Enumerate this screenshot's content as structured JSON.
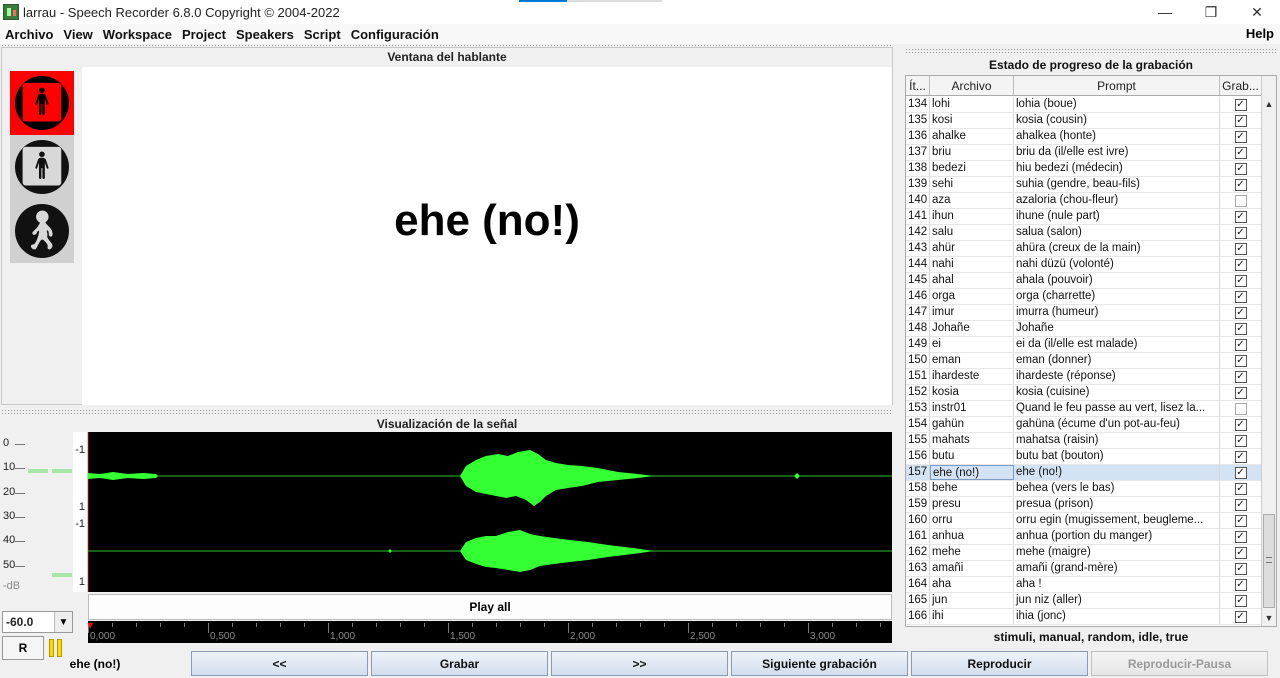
{
  "window": {
    "title": "larrau - Speech Recorder 6.8.0 Copyright © 2004-2022",
    "controls": [
      "—",
      "❐",
      "✕"
    ]
  },
  "menu": {
    "items": [
      "Archivo",
      "View",
      "Workspace",
      "Project",
      "Speakers",
      "Script",
      "Configuración"
    ],
    "help": "Help"
  },
  "speaker_window": {
    "title": "Ventana del hablante",
    "prompt": "ehe (no!)",
    "lights": [
      "stop",
      "wait",
      "go"
    ]
  },
  "signal": {
    "title": "Visualización de la señal",
    "meter_labels": [
      "0",
      "10",
      "20",
      "30",
      "40",
      "50"
    ],
    "meter_unit": "-dB",
    "db_value": "-60.0",
    "r_label": "R",
    "channel_axis": [
      "-1",
      "1",
      "-1",
      "1"
    ],
    "play_all": "Play all",
    "timeline": [
      "0,000",
      "0,500",
      "1,000",
      "1,500",
      "2,000",
      "2,500",
      "3,000"
    ]
  },
  "progress": {
    "title": "Estado de progreso de la grabación",
    "columns": [
      "Ít...",
      "Archivo",
      "Prompt",
      "Grab..."
    ],
    "rows": [
      {
        "n": "134",
        "file": "lohi",
        "prompt": "lohia (boue)",
        "rec": "✓"
      },
      {
        "n": "135",
        "file": "kosi",
        "prompt": "kosia (cousin)",
        "rec": "✓"
      },
      {
        "n": "136",
        "file": "ahalke",
        "prompt": "ahalkea (honte)",
        "rec": "✓"
      },
      {
        "n": "137",
        "file": "briu",
        "prompt": "briu da (il/elle est ivre)",
        "rec": "✓"
      },
      {
        "n": "138",
        "file": "bedezi",
        "prompt": "hiu bedezi (médecin)",
        "rec": "✓"
      },
      {
        "n": "139",
        "file": "sehi",
        "prompt": "suhia (gendre, beau-fils)",
        "rec": "✓"
      },
      {
        "n": "140",
        "file": "aza",
        "prompt": "azaloria (chou-fleur)",
        "rec": ""
      },
      {
        "n": "141",
        "file": "ihun",
        "prompt": "ihune (nule part)",
        "rec": "✓"
      },
      {
        "n": "142",
        "file": "salu",
        "prompt": "salua (salon)",
        "rec": "✓"
      },
      {
        "n": "143",
        "file": "ahür",
        "prompt": "ahüra (creux de la main)",
        "rec": "✓"
      },
      {
        "n": "144",
        "file": "nahi",
        "prompt": "nahi düzü (volonté)",
        "rec": "✓"
      },
      {
        "n": "145",
        "file": "ahal",
        "prompt": "ahala (pouvoir)",
        "rec": "✓"
      },
      {
        "n": "146",
        "file": "orga",
        "prompt": "orga (charrette)",
        "rec": "✓"
      },
      {
        "n": "147",
        "file": "imur",
        "prompt": "imurra (humeur)",
        "rec": "✓"
      },
      {
        "n": "148",
        "file": "Johañe",
        "prompt": "Johañe",
        "rec": "✓"
      },
      {
        "n": "149",
        "file": "ei",
        "prompt": "ei da (il/elle est malade)",
        "rec": "✓"
      },
      {
        "n": "150",
        "file": "eman",
        "prompt": "eman (donner)",
        "rec": "✓"
      },
      {
        "n": "151",
        "file": "ihardeste",
        "prompt": "ihardeste (réponse)",
        "rec": "✓"
      },
      {
        "n": "152",
        "file": "kosia",
        "prompt": "kosia (cuisine)",
        "rec": "✓"
      },
      {
        "n": "153",
        "file": "instr01",
        "prompt": "Quand le feu passe au vert, lisez la...",
        "rec": ""
      },
      {
        "n": "154",
        "file": "gahün",
        "prompt": "gahüna (écume d'un pot-au-feu)",
        "rec": "✓"
      },
      {
        "n": "155",
        "file": "mahats",
        "prompt": "mahatsa (raisin)",
        "rec": "✓"
      },
      {
        "n": "156",
        "file": "butu",
        "prompt": "butu bat (bouton)",
        "rec": "✓"
      },
      {
        "n": "157",
        "file": "ehe (no!)",
        "prompt": "ehe (no!)",
        "rec": "✓"
      },
      {
        "n": "158",
        "file": "behe",
        "prompt": "behea (vers le bas)",
        "rec": "✓"
      },
      {
        "n": "159",
        "file": "presu",
        "prompt": "presua (prison)",
        "rec": "✓"
      },
      {
        "n": "160",
        "file": "orru",
        "prompt": "orru egin (mugissement, beugleme...",
        "rec": "✓"
      },
      {
        "n": "161",
        "file": "anhua",
        "prompt": "anhua (portion du manger)",
        "rec": "✓"
      },
      {
        "n": "162",
        "file": "mehe",
        "prompt": "mehe (maigre)",
        "rec": "✓"
      },
      {
        "n": "163",
        "file": "amañi",
        "prompt": "amañi (grand-mère)",
        "rec": "✓"
      },
      {
        "n": "164",
        "file": "aha",
        "prompt": "aha !",
        "rec": "✓"
      },
      {
        "n": "165",
        "file": "jun",
        "prompt": "jun niz (aller)",
        "rec": "✓"
      },
      {
        "n": "166",
        "file": "ihi",
        "prompt": "ihia (jonc)",
        "rec": "✓"
      }
    ],
    "selected_index": 23,
    "status": "stimuli, manual, random, idle, true"
  },
  "bottom": {
    "current_item": "ehe (no!)",
    "buttons": [
      "<<",
      "Grabar",
      ">>",
      "Siguiente grabación",
      "Reproducir",
      "Reproducir-Pausa"
    ]
  },
  "colors": {
    "waveform": "#33ff33",
    "stop_light": "#ff0000",
    "button_border": "#8a9bb3"
  }
}
